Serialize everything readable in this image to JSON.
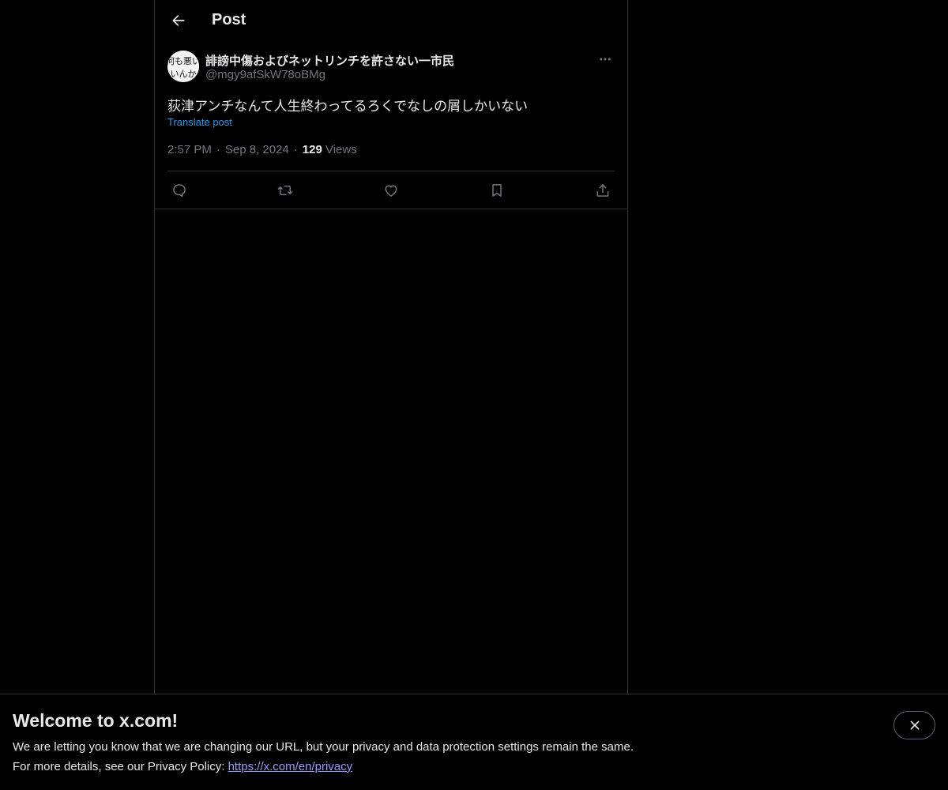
{
  "header": {
    "title": "Post",
    "back_icon": "arrow-left-icon"
  },
  "post": {
    "author": {
      "display_name": "誹謗中傷およびネットリンチを許さない一市民",
      "handle": "@mgy9afSkW78oBMg",
      "avatar_text": "何も悪い いんか"
    },
    "text": "荻津アンチなんて人生終わってるろくでなしの屑しかいない",
    "translate_label": "Translate post",
    "time": "2:57 PM",
    "date": "Sep 8, 2024",
    "separator": "·",
    "views_count": "129",
    "views_label": "Views",
    "actions": [
      "reply-icon",
      "repost-icon",
      "like-icon",
      "bookmark-icon",
      "share-icon"
    ]
  },
  "banner": {
    "title": "Welcome to x.com!",
    "line1": "We are letting you know that we are changing our URL, but your privacy and data protection settings remain the same.",
    "line2_prefix": "For more details, see our Privacy Policy: ",
    "privacy_link": "https://x.com/en/privacy"
  },
  "colors": {
    "background": "#000000",
    "text": "#e7e9ea",
    "secondary": "#71767b",
    "accent": "#1d9bf0",
    "border": "#2f3336"
  }
}
